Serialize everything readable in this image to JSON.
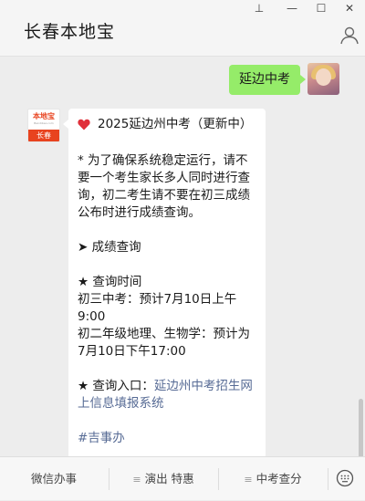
{
  "window": {
    "title": "长春本地宝",
    "controls": {
      "pin": "⊥",
      "minimize": "—",
      "maximize": "☐",
      "close": "✕"
    }
  },
  "user_message": {
    "text": "延边中考"
  },
  "bot": {
    "logo_text": "本地宝",
    "logo_sub": "Bendibao.com",
    "logo_city": "长春"
  },
  "bot_message": {
    "title": "2025延边州中考（更新中）",
    "notice": "* 为了确保系统稳定运行，请不要一个考生家长多人同时进行查询，初二考生请不要在初三成绩公布时进行成绩查询。",
    "section": "➤ 成绩查询",
    "time_heading": "★ 查询时间",
    "time_line1": "初三中考：预计7月10日上午9:00",
    "time_line2": "初二年级地理、生物学：预计为7月10日下午17:00",
    "entry_prefix": "★ 查询入口：",
    "entry_link": "延边州中考招生网上信息填报系统",
    "tag": "#吉事办"
  },
  "bottom_menu": [
    {
      "label": "微信办事",
      "icon": ""
    },
    {
      "label": "演出 特惠",
      "icon": "≡"
    },
    {
      "label": "中考查分",
      "icon": "≡"
    }
  ],
  "colors": {
    "user_bubble": "#95ec69",
    "link": "#576b95",
    "logo": "#e8431f",
    "heart": "#e0303a"
  }
}
